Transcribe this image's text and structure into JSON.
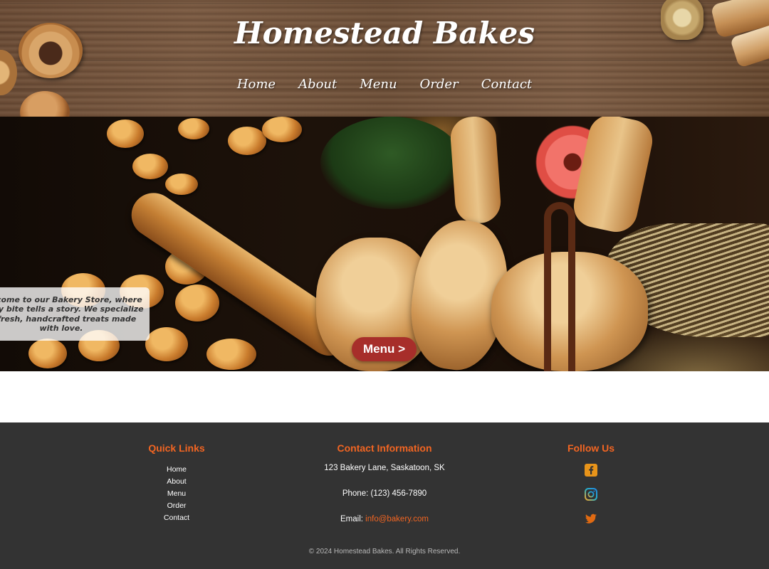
{
  "header": {
    "title": "Homestead Bakes",
    "nav": [
      "Home",
      "About",
      "Menu",
      "Order",
      "Contact"
    ]
  },
  "hero": {
    "welcome_text": "Welcome to our Bakery Store, where every bite tells a story. We specialize in fresh, handcrafted treats made with love.",
    "menu_button": "Menu >"
  },
  "footer": {
    "quick_links": {
      "title": "Quick Links",
      "links": [
        "Home",
        "About",
        "Menu",
        "Order",
        "Contact"
      ]
    },
    "contact": {
      "title": "Contact Information",
      "address": "123 Bakery Lane, Saskatoon, SK",
      "phone": "Phone: (123) 456-7890",
      "email_label": "Email:",
      "email": "info@bakery.com"
    },
    "social": {
      "title": "Follow Us",
      "icons": [
        "facebook-icon",
        "instagram-icon",
        "twitter-icon"
      ]
    },
    "copyright": "© 2024 Homestead Bakes. All Rights Reserved."
  },
  "colors": {
    "accent": "#f26522",
    "menu_button": "#a72e2a",
    "footer_bg": "#333333"
  }
}
